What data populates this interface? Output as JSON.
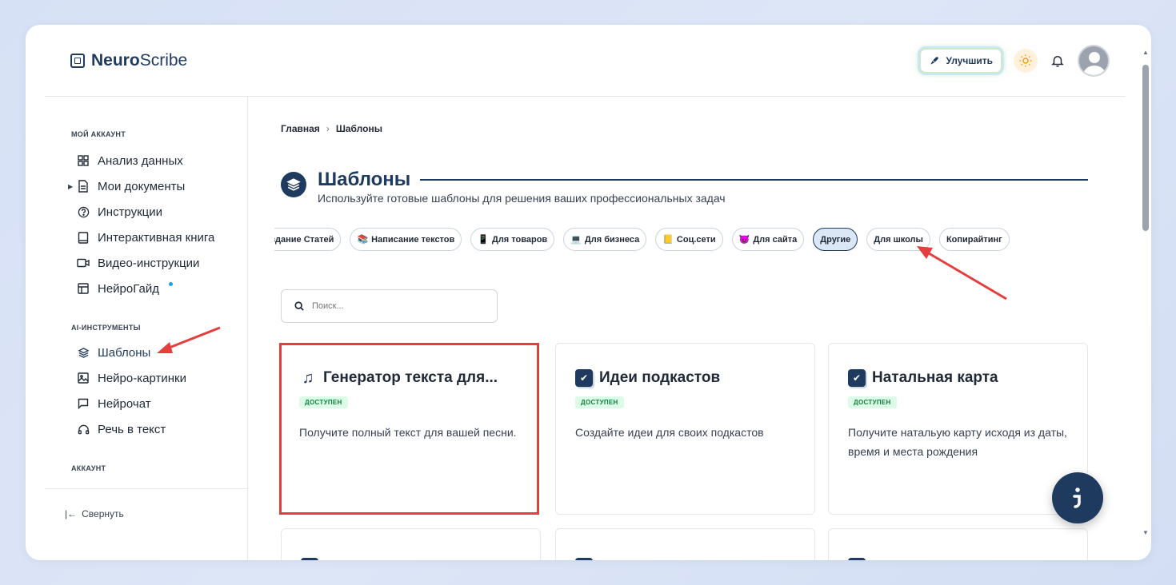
{
  "header": {
    "brand_bold": "Neuro",
    "brand_regular": "Scribe",
    "upgrade_label": "Улучшить"
  },
  "sidebar": {
    "account_section": "МОЙ АККАУНТ",
    "account_items": [
      {
        "label": "Анализ данных",
        "icon": "grid-icon"
      },
      {
        "label": "Мои документы",
        "icon": "document-icon"
      },
      {
        "label": "Инструкции",
        "icon": "help-circle-icon"
      },
      {
        "label": "Интерактивная книга",
        "icon": "book-icon"
      },
      {
        "label": "Видео-инструкции",
        "icon": "video-icon"
      },
      {
        "label": "НейроГайд",
        "icon": "layout-icon"
      }
    ],
    "tools_section": "AI-ИНСТРУМЕНТЫ",
    "tools_items": [
      {
        "label": "Шаблоны",
        "icon": "layers-icon",
        "active": true
      },
      {
        "label": "Нейро-картинки",
        "icon": "image-icon"
      },
      {
        "label": "Нейрочат",
        "icon": "chat-icon"
      },
      {
        "label": "Речь в текст",
        "icon": "headphones-icon"
      }
    ],
    "user_section": "АККАУНТ",
    "collapse_label": "Свернуть"
  },
  "main": {
    "breadcrumb": {
      "home": "Главная",
      "current": "Шаблоны"
    },
    "title": "Шаблоны",
    "subtitle": "Используйте готовые шаблоны для решения ваших профессиональных задач",
    "tabs": [
      {
        "label": "оздание Статей",
        "icon": ""
      },
      {
        "label": "Написание текстов",
        "icon": "📚"
      },
      {
        "label": "Для товаров",
        "icon": "📱"
      },
      {
        "label": "Для бизнеса",
        "icon": "💻"
      },
      {
        "label": "Соц.сети",
        "icon": "📒"
      },
      {
        "label": "Для сайта",
        "icon": "😈"
      },
      {
        "label": "Другие",
        "icon": "",
        "active": true
      },
      {
        "label": "Для школы",
        "icon": ""
      },
      {
        "label": "Копирайтинг",
        "icon": ""
      }
    ],
    "search_placeholder": "Поиск...",
    "cards": [
      {
        "title": "Генератор текста для...",
        "badge": "ДОСТУПЕН",
        "description": "Получите полный текст для вашей песни.",
        "icon": "music-icon"
      },
      {
        "title": "Идеи подкастов",
        "badge": "ДОСТУПЕН",
        "description": "Создайте идеи для своих подкастов",
        "icon": "checkbox-icon"
      },
      {
        "title": "Натальная карта",
        "badge": "ДОСТУПЕН",
        "description": "Получите натальую карту исходя из даты, время и места рождения",
        "icon": "checkbox-icon"
      }
    ]
  },
  "colors": {
    "accent": "#1e3a5f",
    "highlight_border": "#e53e3e",
    "badge_bg": "#dcfce7",
    "badge_text": "#15803d"
  }
}
